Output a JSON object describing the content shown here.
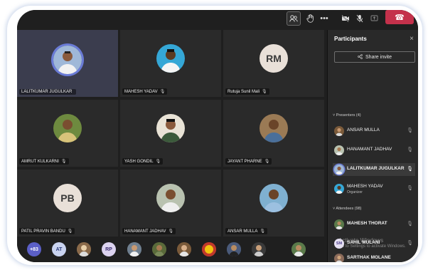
{
  "topbar": {
    "participants_icon": "people-icon",
    "raise_hand_icon": "hand-icon",
    "more_icon": "more-icon",
    "more_label": "•••",
    "camera_icon": "camera-off-icon",
    "mic_icon": "mic-off-icon",
    "share_icon": "share-tray-icon",
    "leave_icon": "phone-hangup-icon",
    "leave_glyph": "☎"
  },
  "tiles": [
    {
      "name": "LALITKUMAR JUGULKAR",
      "type": "photo",
      "mic": ""
    },
    {
      "name": "MAHESH YADAV",
      "type": "photo",
      "mic": "🎙"
    },
    {
      "name": "Rutuja Sunil Mali",
      "type": "initials",
      "initials": "RM",
      "mic": "🎙"
    },
    {
      "name": "AMRUT KULKARNI",
      "type": "photo",
      "mic": "🎙"
    },
    {
      "name": "YASH GONDIL",
      "type": "photo",
      "mic": "🎙"
    },
    {
      "name": "JAYANT PHARNE",
      "type": "photo",
      "mic": "🎙"
    },
    {
      "name": "PATIL PRAVIN BANDU",
      "type": "initials",
      "initials": "PB",
      "mic": "🎙"
    },
    {
      "name": "HANAMANT JADHAV",
      "type": "photo",
      "mic": "🎙"
    },
    {
      "name": "ANSAR MULLA",
      "type": "photo",
      "mic": "🎙"
    }
  ],
  "strip": [
    {
      "label": "+83",
      "bg": "#5b5fc7",
      "fg": "#ffffff"
    },
    {
      "label": "AT",
      "bg": "#c9d3f0",
      "fg": "#2b3a7a"
    },
    {
      "label": "",
      "bg": "#8a6a4a"
    },
    {
      "label": "RP",
      "bg": "#dcd3f0",
      "fg": "#3b2c6e"
    },
    {
      "label": "",
      "bg": "#6f7f8f"
    },
    {
      "label": "",
      "bg": "#5a6a3a"
    },
    {
      "label": "",
      "bg": "#7a5a3a"
    },
    {
      "label": "",
      "bg": "#c0392b"
    },
    {
      "label": "",
      "bg": "#4a5a7a"
    },
    {
      "label": "",
      "bg": "#3a3a3a"
    },
    {
      "label": "",
      "bg": "#5a7a4a"
    }
  ],
  "panel": {
    "title": "Participants",
    "close": "×",
    "share_invite": "Share invite",
    "presenters_header": "˅ Presenters (4)",
    "attendees_header": "˅ Attendees (98)",
    "presenters": [
      {
        "name": "ANSAR MULLA",
        "sub": "",
        "mic": "🎙",
        "bold": false
      },
      {
        "name": "HANAMANT JADHAV",
        "sub": "",
        "mic": "🎙",
        "bold": false
      },
      {
        "name": "LALITKUMAR JUGULKAR",
        "sub": "",
        "mic": "🎙",
        "bold": true
      },
      {
        "name": "MAHESH YADAV",
        "sub": "Organizer",
        "mic": "🎙",
        "bold": false
      }
    ],
    "attendees": [
      {
        "name": "MAHESH THORAT",
        "sub": "",
        "mic": "🎙",
        "initials": ""
      },
      {
        "name": "SAHIL MULANI",
        "sub": "",
        "mic": "🎙",
        "initials": "SM"
      },
      {
        "name": "SARTHAK MOLANE",
        "sub": "",
        "mic": "",
        "initials": ""
      }
    ]
  },
  "watermark": {
    "line1": "Activate Windows",
    "line2": "Go to Settings to activate Windows."
  }
}
